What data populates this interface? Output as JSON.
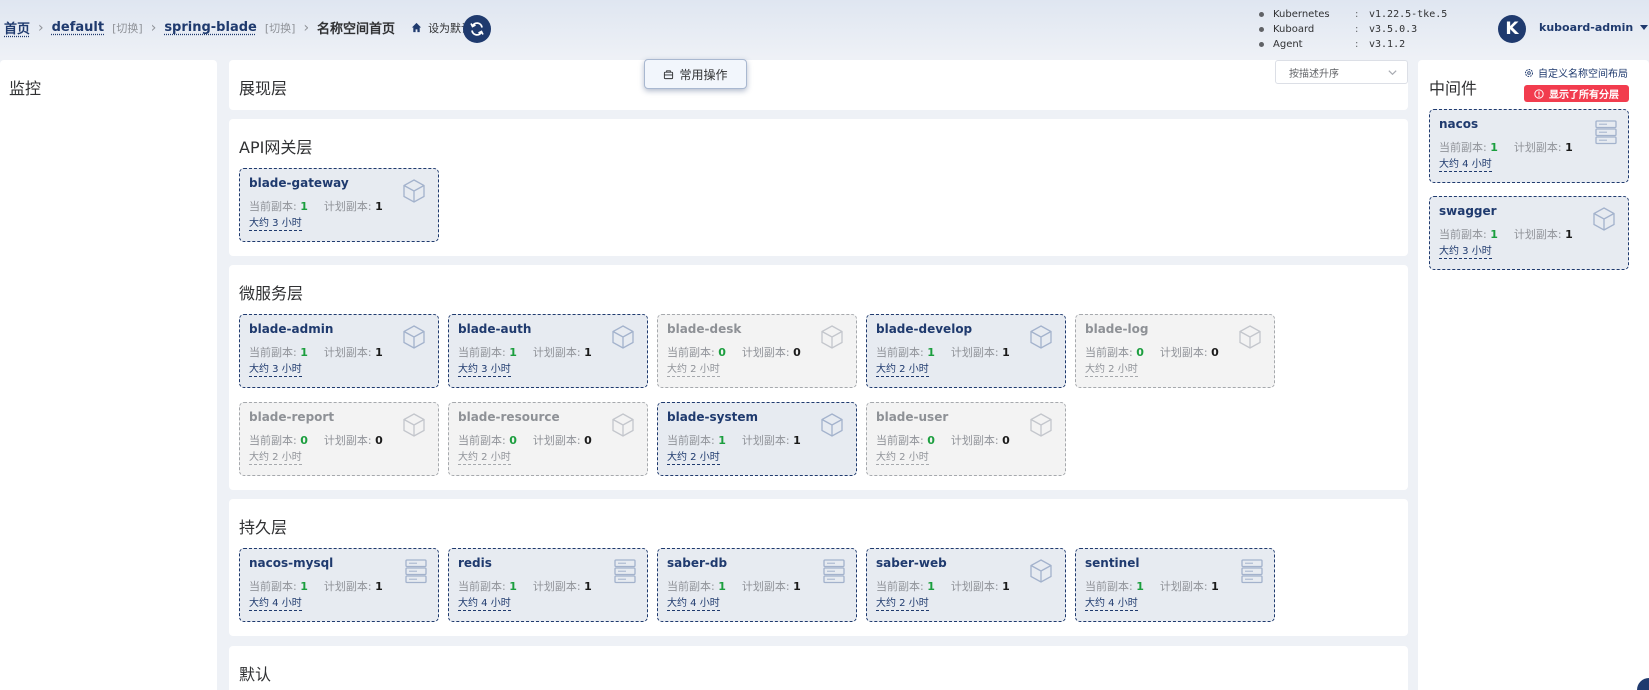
{
  "breadcrumb": {
    "home": "首页",
    "namespace": "default",
    "switch1": "[切换]",
    "app": "spring-blade",
    "switch2": "[切换]",
    "current": "名称空间首页",
    "set_default": "设为默认页"
  },
  "versions": [
    {
      "name": "Kubernetes",
      "value": "v1.22.5-tke.5"
    },
    {
      "name": "Kuboard",
      "value": "v3.5.0.3"
    },
    {
      "name": "Agent",
      "value": "v3.1.2"
    }
  ],
  "user": {
    "avatar_letter": "K",
    "name": "kuboard-admin"
  },
  "toolbar": {
    "common_ops": "常用操作",
    "sort_label": "按描述升序"
  },
  "right_panel": {
    "title": "中间件",
    "custom_layout": "自定义名称空间布局",
    "show_all": "显示了所有分层"
  },
  "left_panel": {
    "title": "监控"
  },
  "labels": {
    "current": "当前副本:",
    "planned": "计划副本:"
  },
  "sections": {
    "presentation": {
      "title": "展现层"
    },
    "gateway": {
      "title": "API网关层"
    },
    "micro": {
      "title": "微服务层"
    },
    "persistence": {
      "title": "持久层"
    },
    "default": {
      "title": "默认"
    }
  },
  "cards": {
    "blade_gateway": {
      "name": "blade-gateway",
      "current": "1",
      "planned": "1",
      "age": "大约 3 小时",
      "active": true,
      "icon": "cube-icon"
    },
    "blade_admin": {
      "name": "blade-admin",
      "current": "1",
      "planned": "1",
      "age": "大约 3 小时",
      "active": true,
      "icon": "cube-icon"
    },
    "blade_auth": {
      "name": "blade-auth",
      "current": "1",
      "planned": "1",
      "age": "大约 3 小时",
      "active": true,
      "icon": "cube-icon"
    },
    "blade_desk": {
      "name": "blade-desk",
      "current": "0",
      "planned": "0",
      "age": "大约 2 小时",
      "active": false,
      "icon": "cube-icon"
    },
    "blade_develop": {
      "name": "blade-develop",
      "current": "1",
      "planned": "1",
      "age": "大约 2 小时",
      "active": true,
      "icon": "cube-icon"
    },
    "blade_log": {
      "name": "blade-log",
      "current": "0",
      "planned": "0",
      "age": "大约 2 小时",
      "active": false,
      "icon": "cube-icon"
    },
    "blade_report": {
      "name": "blade-report",
      "current": "0",
      "planned": "0",
      "age": "大约 2 小时",
      "active": false,
      "icon": "cube-icon"
    },
    "blade_resource": {
      "name": "blade-resource",
      "current": "0",
      "planned": "0",
      "age": "大约 2 小时",
      "active": false,
      "icon": "cube-icon"
    },
    "blade_system": {
      "name": "blade-system",
      "current": "1",
      "planned": "1",
      "age": "大约 2 小时",
      "active": true,
      "icon": "cube-icon"
    },
    "blade_user": {
      "name": "blade-user",
      "current": "0",
      "planned": "0",
      "age": "大约 2 小时",
      "active": false,
      "icon": "cube-icon"
    },
    "nacos_mysql": {
      "name": "nacos-mysql",
      "current": "1",
      "planned": "1",
      "age": "大约 4 小时",
      "active": true,
      "icon": "database-icon"
    },
    "redis": {
      "name": "redis",
      "current": "1",
      "planned": "1",
      "age": "大约 4 小时",
      "active": true,
      "icon": "database-icon"
    },
    "saber_db": {
      "name": "saber-db",
      "current": "1",
      "planned": "1",
      "age": "大约 4 小时",
      "active": true,
      "icon": "database-icon"
    },
    "saber_web": {
      "name": "saber-web",
      "current": "1",
      "planned": "1",
      "age": "大约 2 小时",
      "active": true,
      "icon": "cube-icon"
    },
    "sentinel": {
      "name": "sentinel",
      "current": "1",
      "planned": "1",
      "age": "大约 4 小时",
      "active": true,
      "icon": "database-icon"
    },
    "nacos": {
      "name": "nacos",
      "current": "1",
      "planned": "1",
      "age": "大约 4 小时",
      "active": true,
      "icon": "database-icon"
    },
    "swagger": {
      "name": "swagger",
      "current": "1",
      "planned": "1",
      "age": "大约 3 小时",
      "active": true,
      "icon": "cube-icon"
    }
  },
  "colors": {
    "primary": "#1f3a6e",
    "danger": "#f23c4e",
    "success": "#1b9e3e"
  }
}
